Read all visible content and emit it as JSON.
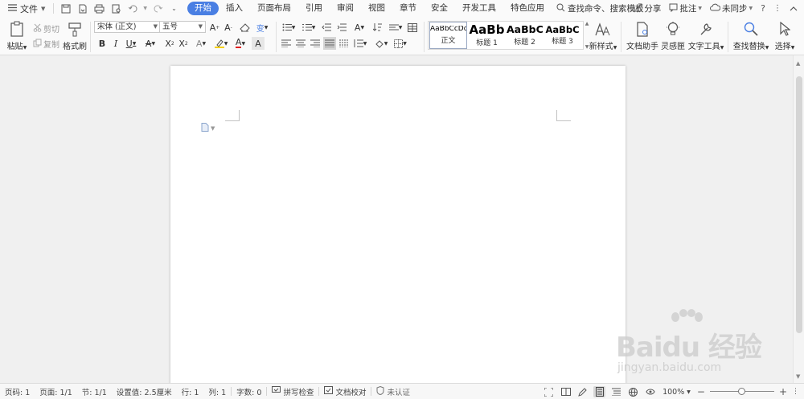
{
  "menubar": {
    "file_label": "文件",
    "tabs": [
      {
        "label": "开始",
        "active": true
      },
      {
        "label": "插入"
      },
      {
        "label": "页面布局"
      },
      {
        "label": "引用"
      },
      {
        "label": "审阅"
      },
      {
        "label": "视图"
      },
      {
        "label": "章节"
      },
      {
        "label": "安全"
      },
      {
        "label": "开发工具"
      },
      {
        "label": "特色应用"
      }
    ],
    "search_placeholder": "查找命令、搜索模板",
    "share_label": "分享",
    "comment_label": "批注",
    "sync_label": "未同步"
  },
  "ribbon": {
    "paste_label": "粘贴",
    "cut_label": "剪切",
    "copy_label": "复制",
    "format_painter_label": "格式刷",
    "font_name": "宋体 (正文)",
    "font_size": "五号",
    "styles": [
      {
        "preview": "AaBbCcDd",
        "label": "正文",
        "selected": true
      },
      {
        "preview": "AaBb",
        "label": "标题 1"
      },
      {
        "preview": "AaBbC",
        "label": "标题 2"
      },
      {
        "preview": "AaBbC",
        "label": "标题 3"
      }
    ],
    "new_style_label": "新样式",
    "doc_assistant_label": "文档助手",
    "inspiration_label": "灵感匣",
    "text_tools_label": "文字工具",
    "find_replace_label": "查找替换",
    "select_label": "选择"
  },
  "statusbar": {
    "page_num": "页码: 1",
    "pages": "页面: 1/1",
    "section": "节: 1/1",
    "setting": "设置值: 2.5厘米",
    "row": "行: 1",
    "col": "列: 1",
    "word_count": "字数: 0",
    "spell_check": "拼写检查",
    "doc_proof": "文档校对",
    "cert": "未认证",
    "zoom": "100%"
  },
  "watermark": {
    "main": "Baidu 经验",
    "sub": "jingyan.baidu.com"
  },
  "colors": {
    "accent": "#4a7fe3",
    "page": "#ffffff",
    "workspace": "#f0f0f0"
  }
}
